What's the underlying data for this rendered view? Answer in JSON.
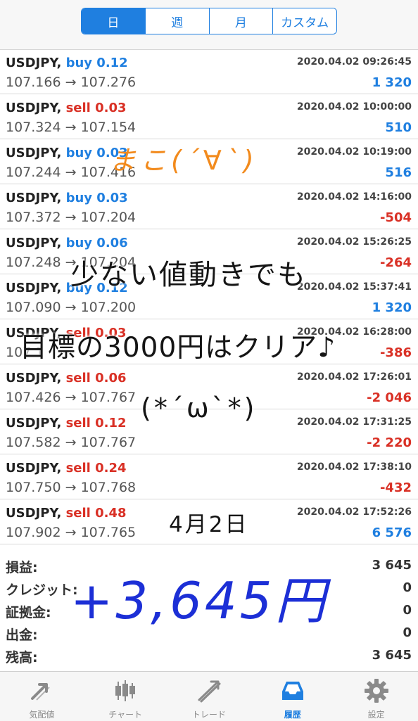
{
  "period_tabs": [
    "日",
    "週",
    "月",
    "カスタム"
  ],
  "trades": [
    {
      "symbol": "USDJPY,",
      "side": "buy",
      "volume": "buy 0.12",
      "time": "2020.04.02 09:26:45",
      "prices": "107.166 → 107.276",
      "profit": "1 320"
    },
    {
      "symbol": "USDJPY,",
      "side": "sell",
      "volume": "sell 0.03",
      "time": "2020.04.02 10:00:00",
      "prices": "107.324 → 107.154",
      "profit": "510"
    },
    {
      "symbol": "USDJPY,",
      "side": "buy",
      "volume": "buy 0.03",
      "time": "2020.04.02 10:19:00",
      "prices": "107.244 → 107.416",
      "profit": "516"
    },
    {
      "symbol": "USDJPY,",
      "side": "buy",
      "volume": "buy 0.03",
      "time": "2020.04.02 14:16:00",
      "prices": "107.372 → 107.204",
      "profit": "-504"
    },
    {
      "symbol": "USDJPY,",
      "side": "buy",
      "volume": "buy 0.06",
      "time": "2020.04.02 15:26:25",
      "prices": "107.248 → 107.204",
      "profit": "-264"
    },
    {
      "symbol": "USDJPY,",
      "side": "buy",
      "volume": "buy 0.12",
      "time": "2020.04.02 15:37:41",
      "prices": "107.090 → 107.200",
      "profit": "1 320"
    },
    {
      "symbol": "USDJPY,",
      "side": "sell",
      "volume": "sell 0.03",
      "time": "2020.04.02 16:28:00",
      "prices": "107.1",
      "profit": "-386"
    },
    {
      "symbol": "USDJPY,",
      "side": "sell",
      "volume": "sell 0.06",
      "time": "2020.04.02 17:26:01",
      "prices": "107.426 → 107.767",
      "profit": "-2 046"
    },
    {
      "symbol": "USDJPY,",
      "side": "sell",
      "volume": "sell 0.12",
      "time": "2020.04.02 17:31:25",
      "prices": "107.582 → 107.767",
      "profit": "-2 220"
    },
    {
      "symbol": "USDJPY,",
      "side": "sell",
      "volume": "sell 0.24",
      "time": "2020.04.02 17:38:10",
      "prices": "107.750 → 107.768",
      "profit": "-432"
    },
    {
      "symbol": "USDJPY,",
      "side": "sell",
      "volume": "sell 0.48",
      "time": "2020.04.02 17:52:26",
      "prices": "107.902 → 107.765",
      "profit": "6 576"
    }
  ],
  "summary": [
    {
      "label": "損益:",
      "value": "3 645"
    },
    {
      "label": "クレジット:",
      "value": "0"
    },
    {
      "label": "証拠金:",
      "value": "0"
    },
    {
      "label": "出金:",
      "value": "0"
    },
    {
      "label": "残高:",
      "value": "3 645"
    }
  ],
  "handwriting": {
    "face1": "まこ(´∀`)",
    "line1": "少ない値動きでも",
    "line2": "目標の3000円はクリア♪",
    "face2": "(*´ω`*)",
    "date": "4月2日",
    "amount": "+3,645円"
  },
  "tabbar": [
    {
      "label": "気配値",
      "icon": "quotes-icon",
      "active": false
    },
    {
      "label": "チャート",
      "icon": "chart-icon",
      "active": false
    },
    {
      "label": "トレード",
      "icon": "trade-icon",
      "active": false
    },
    {
      "label": "履歴",
      "icon": "history-icon",
      "active": true
    },
    {
      "label": "設定",
      "icon": "settings-icon",
      "active": false
    }
  ],
  "colors": {
    "accent": "#1f7fe0",
    "negative": "#d93025",
    "handwriting_orange": "#f28a1c",
    "handwriting_blue": "#1c2fd6"
  }
}
